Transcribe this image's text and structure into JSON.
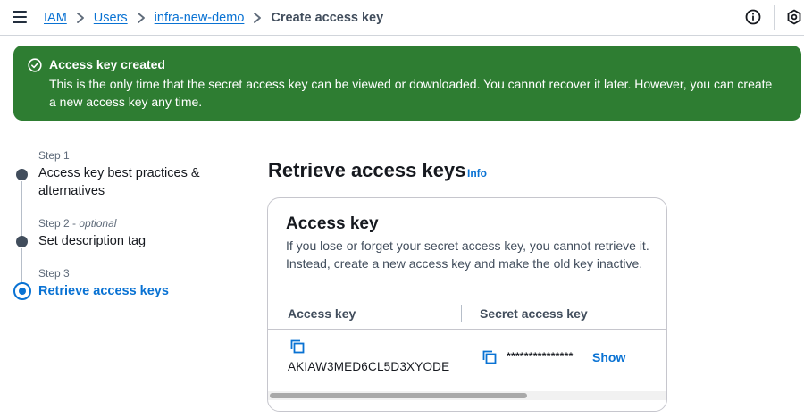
{
  "breadcrumbs": [
    {
      "label": "IAM"
    },
    {
      "label": "Users"
    },
    {
      "label": "infra-new-demo"
    },
    {
      "label": "Create access key"
    }
  ],
  "flash": {
    "title": "Access key created",
    "message": "This is the only time that the secret access key can be viewed or downloaded. You cannot recover it later. However, you can create a new access key any time.",
    "color": "#2e7d32"
  },
  "steps": [
    {
      "number": "Step 1",
      "optional": "",
      "label": "Access key best practices & alternatives",
      "state": "completed"
    },
    {
      "number": "Step 2",
      "optional": "optional",
      "label": "Set description tag",
      "state": "completed"
    },
    {
      "number": "Step 3",
      "optional": "",
      "label": "Retrieve access keys",
      "state": "active"
    }
  ],
  "main": {
    "title": "Retrieve access keys",
    "info_link": "Info"
  },
  "card": {
    "title": "Access key",
    "description": "If you lose or forget your secret access key, you cannot retrieve it. Instead, create a new access key and make the old key inactive.",
    "columns": [
      "Access key",
      "Secret access key"
    ],
    "access_key": "AKIAW3MED6CL5D3XYODE",
    "secret_masked": "***************",
    "show_label": "Show"
  },
  "colors": {
    "link": "#0972d3",
    "text": "#16191f",
    "success": "#2e7d32"
  },
  "icons": [
    "menu-icon",
    "chevron-right-icon",
    "info-circle-icon",
    "hexagon-icon",
    "check-circle-icon",
    "copy-icon"
  ]
}
